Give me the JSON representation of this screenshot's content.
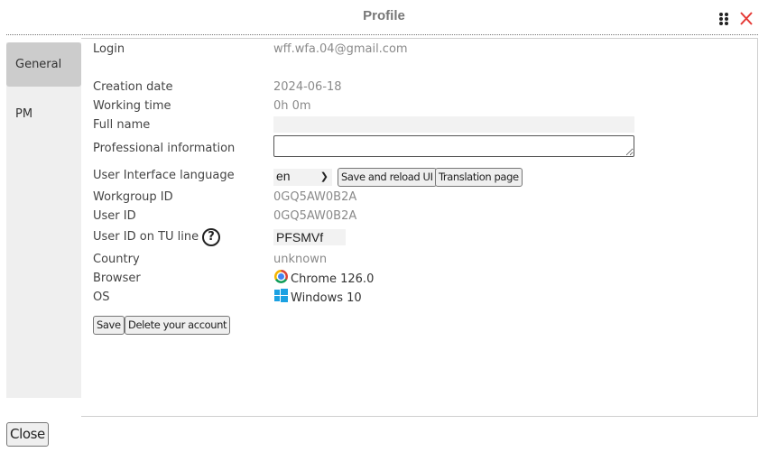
{
  "header": {
    "title": "Profile",
    "drag_icon": "drag-handle-icon",
    "close_icon": "close-x-icon",
    "close_color": "#e53935"
  },
  "sidebar": {
    "tabs": [
      {
        "label": "General",
        "active": true
      },
      {
        "label": "PM",
        "active": false
      }
    ]
  },
  "form": {
    "login": {
      "label": "Login",
      "value": "wff.wfa.04@gmail.com"
    },
    "creation_date": {
      "label": "Creation date",
      "value": "2024-06-18"
    },
    "working_time": {
      "label": "Working time",
      "value": "0h 0m"
    },
    "full_name": {
      "label": "Full name",
      "value": ""
    },
    "professional_information": {
      "label": "Professional information",
      "value": ""
    },
    "ui_language": {
      "label": "User Interface language",
      "selected": "en",
      "save_reload_label": "Save and reload UI",
      "translation_page_label": "Translation page"
    },
    "workgroup_id": {
      "label": "Workgroup ID",
      "value": "0GQ5AW0B2A"
    },
    "user_id": {
      "label": "User ID",
      "value": "0GQ5AW0B2A"
    },
    "user_id_tu_line": {
      "label": "User ID on TU line",
      "help_icon": "?",
      "value": "PFSMVf"
    },
    "country": {
      "label": "Country",
      "value": "unknown"
    },
    "browser": {
      "label": "Browser",
      "icon": "chrome-icon",
      "value": "Chrome 126.0"
    },
    "os": {
      "label": "OS",
      "icon": "windows-icon",
      "value": "Windows 10"
    },
    "save_label": "Save",
    "delete_label": "Delete your account"
  },
  "footer": {
    "close_label": "Close"
  }
}
